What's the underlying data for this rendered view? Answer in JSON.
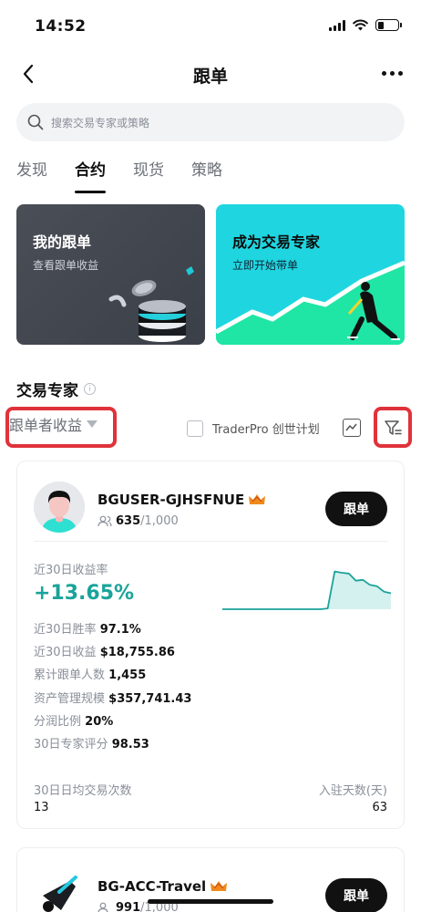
{
  "status": {
    "time": "14:52"
  },
  "nav": {
    "title": "跟单"
  },
  "search": {
    "placeholder": "搜索交易专家或策略"
  },
  "tabs": [
    {
      "label": "发现",
      "active": false
    },
    {
      "label": "合约",
      "active": true
    },
    {
      "label": "现货",
      "active": false
    },
    {
      "label": "策略",
      "active": false
    }
  ],
  "banners": {
    "my": {
      "title": "我的跟单",
      "subtitle": "查看跟单收益"
    },
    "expert": {
      "title": "成为交易专家",
      "subtitle": "立即开始带单"
    }
  },
  "section": {
    "title": "交易专家",
    "info": "i"
  },
  "filters": {
    "sort_label": "跟单者收益",
    "traderpro_label": "TraderPro 创世计划"
  },
  "traders": [
    {
      "name": "BGUSER-GJHSFNUE",
      "followers": "635",
      "followers_max": "/1,000",
      "button": "跟单",
      "roi_label": "近30日收益率",
      "roi_value": "+13.65%",
      "stats": [
        {
          "label": "近30日胜率",
          "value": "97.1%"
        },
        {
          "label": "近30日收益",
          "value": "$18,755.86"
        },
        {
          "label": "累计跟单人数",
          "value": "1,455"
        },
        {
          "label": "资产管理规模",
          "value": "$357,741.43"
        },
        {
          "label": "分润比例",
          "value": "20%"
        },
        {
          "label": "30日专家评分",
          "value": "98.53"
        }
      ],
      "footer_left_label": "30日日均交易次数",
      "footer_left_value": "13",
      "footer_right_label": "入驻天数(天)",
      "footer_right_value": "63",
      "chart_data": {
        "type": "area",
        "values": [
          0,
          0,
          0,
          0,
          0,
          0,
          0,
          0,
          0,
          0,
          0,
          0,
          0,
          0,
          0,
          0.02,
          0.9,
          0.87,
          0.85,
          0.68,
          0.7,
          0.58,
          0.55,
          0.42,
          0.38
        ],
        "color": "#1aa39a"
      }
    },
    {
      "name": "BG-ACC-Travel",
      "followers": "991",
      "followers_max": "/1,000",
      "button": "跟单"
    }
  ],
  "colors": {
    "positive": "#1aa39a",
    "highlight_box": "#e0323a",
    "expert_card": "#1fd6e0",
    "my_card": "#43474f"
  }
}
